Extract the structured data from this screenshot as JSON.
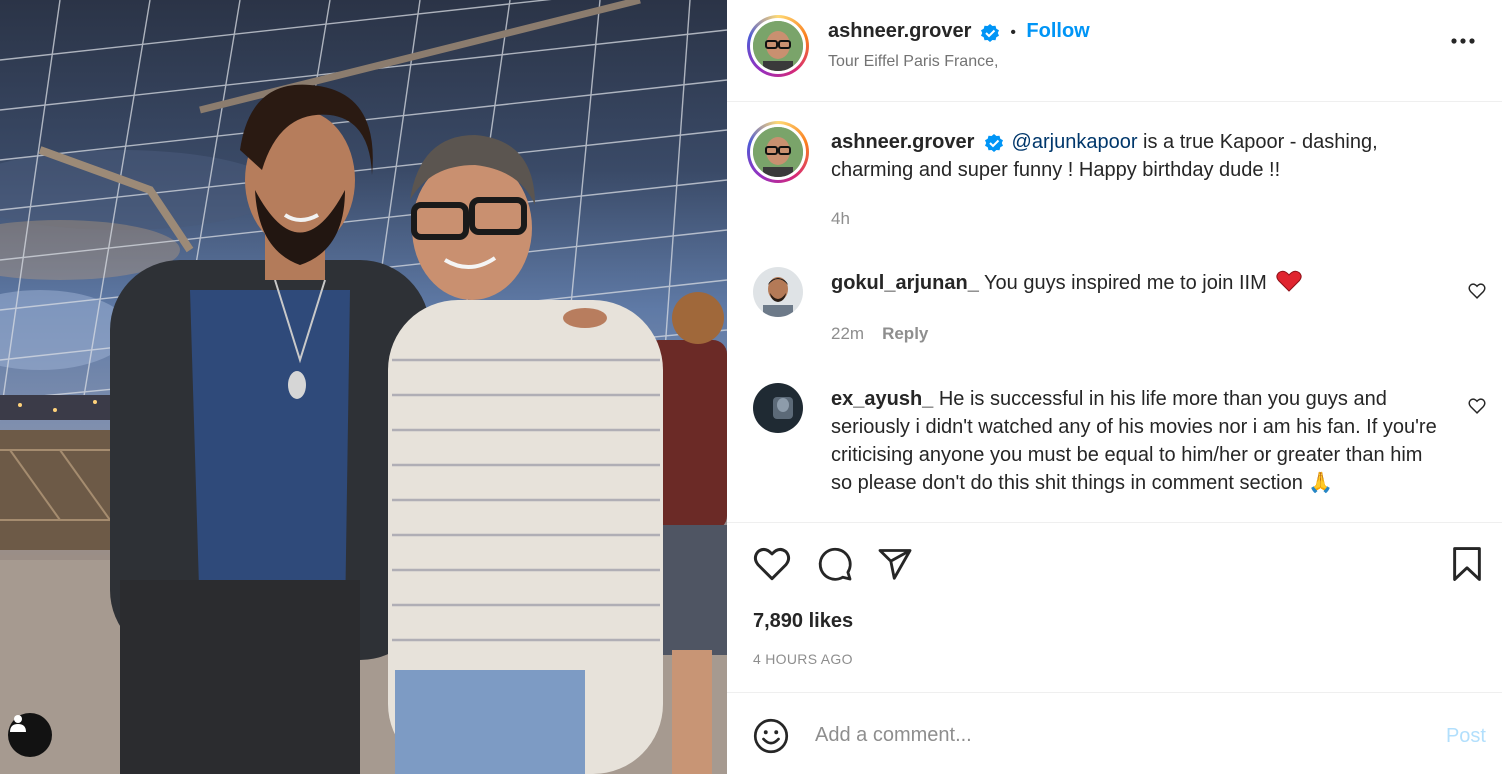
{
  "post": {
    "author": "ashneer.grover",
    "follow_label": "Follow",
    "separator": "•",
    "location": "Tour Eiffel Paris France,",
    "caption_mention": "@arjunkapoor",
    "caption_rest": " is a true Kapoor - dashing, charming and super funny ! Happy birthday dude !!",
    "caption_age": "4h",
    "likes": "7,890 likes",
    "posted_ago": "4 HOURS AGO"
  },
  "comments": [
    {
      "user": "gokul_arjunan_",
      "text": "You guys inspired me to join IIM",
      "age": "22m",
      "reply_label": "Reply"
    },
    {
      "user": "ex_ayush_",
      "text": "He is successful in his life more than you guys and seriously i didn't watched any of his movies nor i am his fan. If you're criticising anyone you must be equal to him/her or greater than him so please don't do this shit things in comment section 🙏"
    }
  ],
  "composer": {
    "placeholder": "Add a comment...",
    "post_label": "Post"
  },
  "colors": {
    "accent": "#0095f6",
    "verified": "#0095f6",
    "heart": "#ed4956",
    "muted": "#8e8e8e"
  },
  "icons": [
    "more-options-icon",
    "verified-badge-icon",
    "like-icon",
    "comment-icon",
    "share-icon",
    "save-icon",
    "emoji-icon",
    "user-tag-icon",
    "comment-like-icon"
  ]
}
